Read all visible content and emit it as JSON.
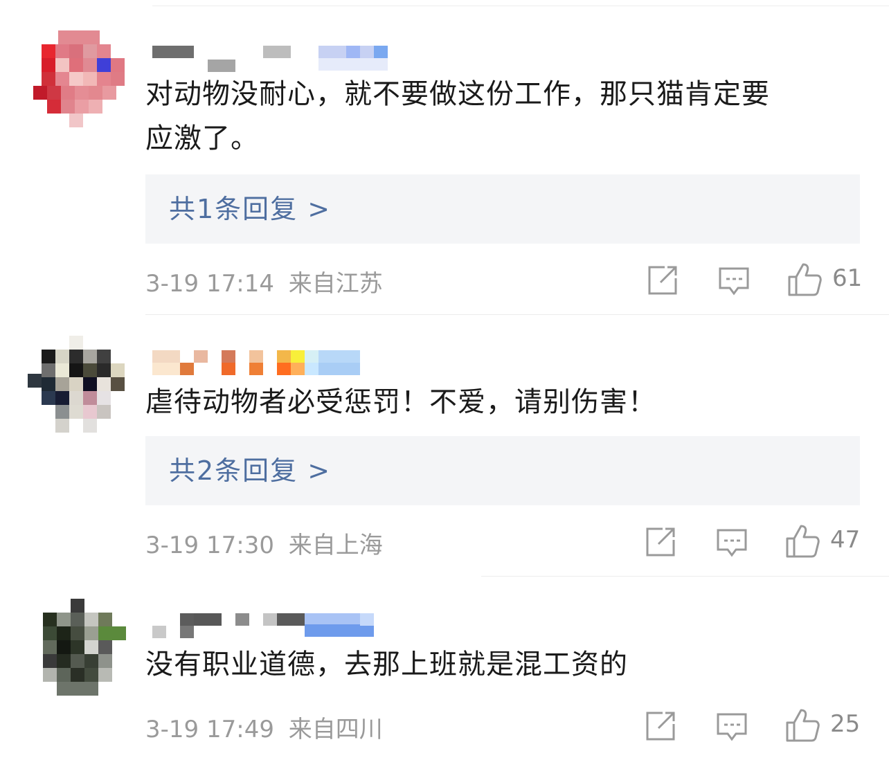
{
  "comments": [
    {
      "text_lines": [
        "对动物没耐心，就不要做这份工作，那只猫肯定要",
        "应激了。"
      ],
      "reply_label": "共1条回复 >",
      "time": "3-19 17:14",
      "location": "来自江苏",
      "likes": "61"
    },
    {
      "text_lines": [
        "虐待动物者必受惩罚！不爱，请别伤害！"
      ],
      "reply_label": "共2条回复 >",
      "time": "3-19 17:30",
      "location": "来自上海",
      "likes": "47"
    },
    {
      "text_lines": [
        "没有职业道德，去那上班就是混工资的"
      ],
      "reply_label": "",
      "time": "3-19 17:49",
      "location": "来自四川",
      "likes": "25"
    }
  ],
  "icons": {
    "share": "share-icon",
    "comment": "comment-icon",
    "like": "thumbs-up-icon"
  },
  "colors": {
    "reply_link": "#4e6ea0",
    "reply_bg": "#f4f5f7",
    "meta_text": "#9a9a9a",
    "body_text": "#1a1a1a"
  }
}
